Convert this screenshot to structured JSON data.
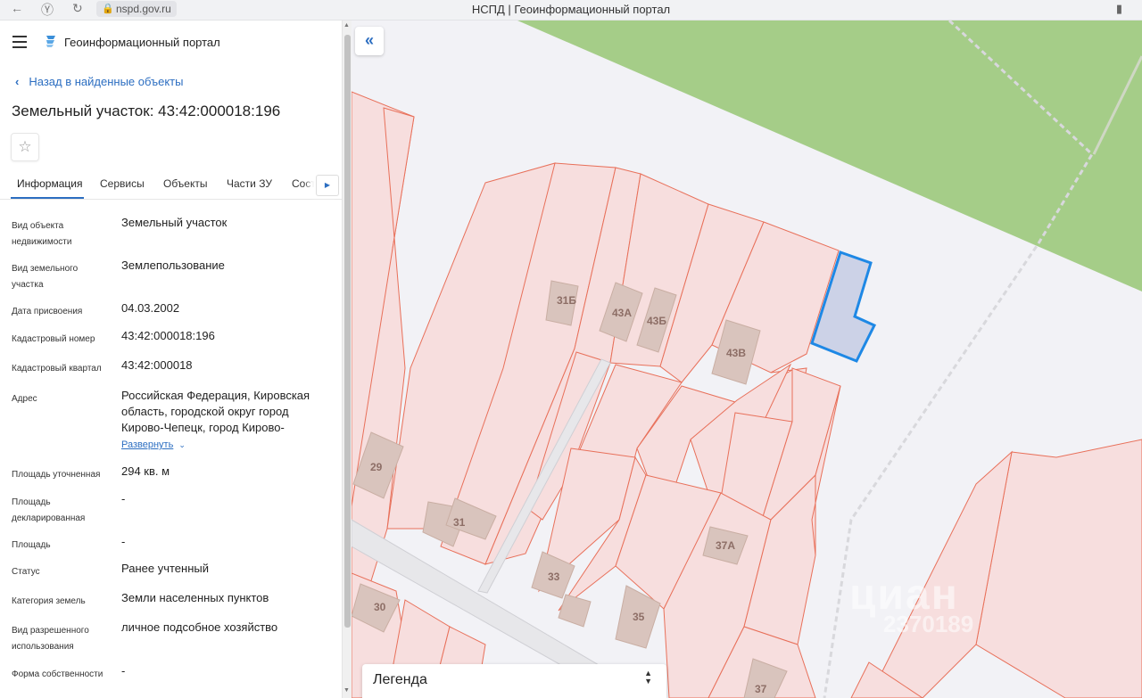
{
  "browser": {
    "url": "nspd.gov.ru",
    "title": "НСПД | Геоинформационный портал"
  },
  "header": {
    "portal_name": "Геоинформационный портал"
  },
  "nav": {
    "back_label": "Назад в найденные объекты"
  },
  "object": {
    "title": "Земельный участок: 43:42:000018:196"
  },
  "tabs": [
    {
      "label": "Информация",
      "active": true
    },
    {
      "label": "Сервисы"
    },
    {
      "label": "Объекты"
    },
    {
      "label": "Части ЗУ"
    },
    {
      "label": "Состав"
    }
  ],
  "info": [
    {
      "label": "Вид объекта недвижимости",
      "value": "Земельный участок"
    },
    {
      "label": "Вид земельного участка",
      "value": "Землепользование"
    },
    {
      "label": "Дата присвоения",
      "value": "04.03.2002"
    },
    {
      "label": "Кадастровый номер",
      "value": "43:42:000018:196"
    },
    {
      "label": "Кадастровый квартал",
      "value": "43:42:000018"
    },
    {
      "label": "Адрес",
      "value": "Российская Федерация, Кировская область, городской округ город Кирово-Чепецк, город Кирово-"
    },
    {
      "label": "Площадь уточненная",
      "value": "294 кв. м"
    },
    {
      "label": "Площадь декларированная",
      "value": "-"
    },
    {
      "label": "Площадь",
      "value": "-"
    },
    {
      "label": "Статус",
      "value": "Ранее учтенный"
    },
    {
      "label": "Категория земель",
      "value": "Земли населенных пунктов"
    },
    {
      "label": "Вид разрешенного использования",
      "value": "личное подсобное хозяйство"
    },
    {
      "label": "Форма собственности",
      "value": "-"
    }
  ],
  "address_expand_label": "Развернуть",
  "map": {
    "legend_label": "Легенда",
    "building_labels": [
      "31Б",
      "43А",
      "43Б",
      "43В",
      "29",
      "31",
      "37А",
      "33",
      "35",
      "30",
      "37"
    ],
    "watermark": "циан",
    "watermark_id": "2370189"
  },
  "colors": {
    "accent": "#2c6ec1",
    "parcel_fill": "#f7dede",
    "parcel_stroke": "#e8705a",
    "forest": "#a5cd88",
    "selected_stroke": "#1e88e5"
  }
}
